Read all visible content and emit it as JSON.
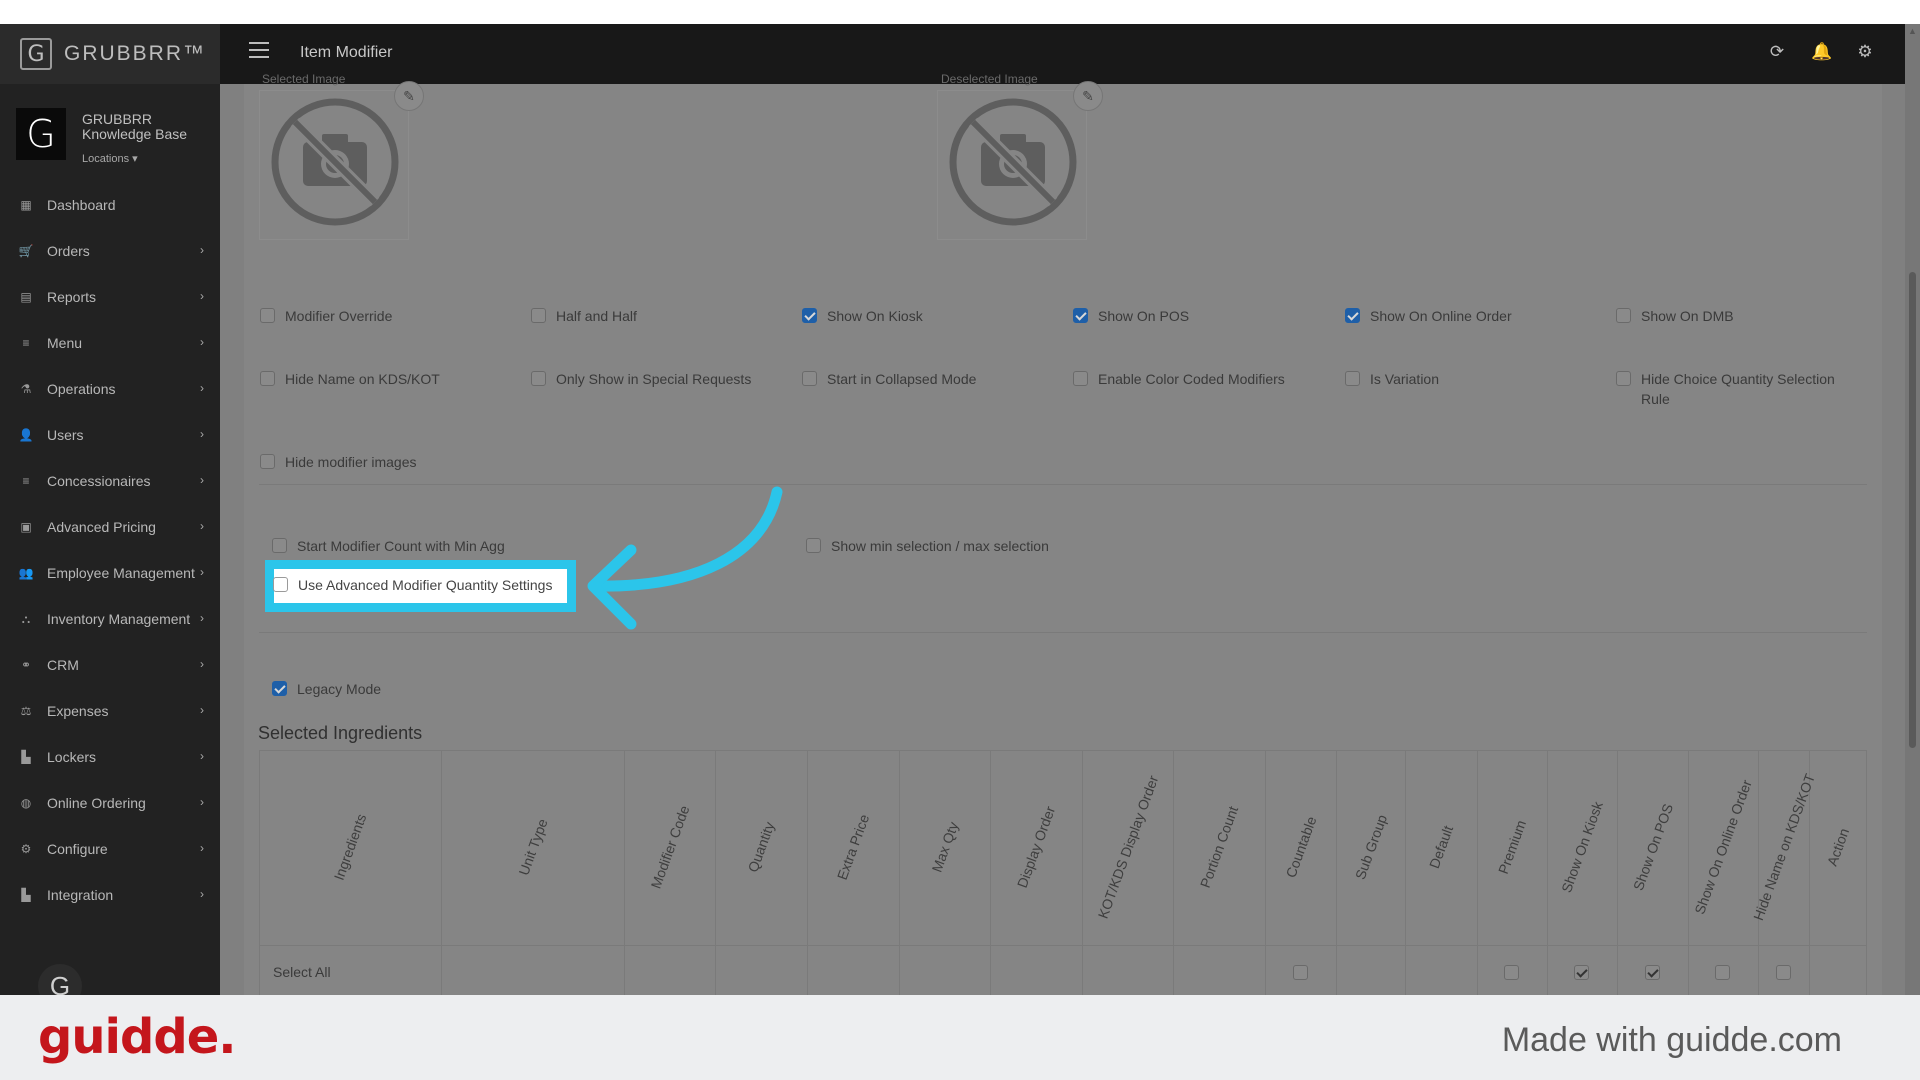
{
  "app": {
    "brand": "GRUBBRR™",
    "brand_letter": "G",
    "page_title": "Item Modifier"
  },
  "header_icons": [
    "refresh-icon",
    "bell-icon",
    "gear-icon"
  ],
  "profile": {
    "name": "GRUBBRR Knowledge Base",
    "locations": "Locations ▾"
  },
  "sidebar": {
    "items": [
      {
        "label": "Dashboard",
        "icon": "▦",
        "chevron": false
      },
      {
        "label": "Orders",
        "icon": "🛒",
        "chevron": true
      },
      {
        "label": "Reports",
        "icon": "▤",
        "chevron": true
      },
      {
        "label": "Menu",
        "icon": "≡",
        "chevron": true
      },
      {
        "label": "Operations",
        "icon": "⚗",
        "chevron": true
      },
      {
        "label": "Users",
        "icon": "👤",
        "chevron": true
      },
      {
        "label": "Concessionaires",
        "icon": "≡",
        "chevron": true
      },
      {
        "label": "Advanced Pricing",
        "icon": "▣",
        "chevron": true
      },
      {
        "label": "Employee Management",
        "icon": "👥",
        "chevron": true
      },
      {
        "label": "Inventory Management",
        "icon": "⛬",
        "chevron": true
      },
      {
        "label": "CRM",
        "icon": "⚭",
        "chevron": true
      },
      {
        "label": "Expenses",
        "icon": "⚖",
        "chevron": true
      },
      {
        "label": "Lockers",
        "icon": "▙",
        "chevron": true
      },
      {
        "label": "Online Ordering",
        "icon": "◍",
        "chevron": true
      },
      {
        "label": "Configure",
        "icon": "⚙",
        "chevron": true
      },
      {
        "label": "Integration",
        "icon": "▙",
        "chevron": true
      }
    ],
    "chevron_glyph": "›",
    "avatar_letter": "G"
  },
  "images": {
    "left_label": "Selected Image",
    "right_label": "Deselected Image"
  },
  "options_row1": [
    {
      "label": "Modifier Override",
      "checked": false
    },
    {
      "label": "Half and Half",
      "checked": false
    },
    {
      "label": "Show On Kiosk",
      "checked": true
    },
    {
      "label": "Show On POS",
      "checked": true
    },
    {
      "label": "Show On Online Order",
      "checked": true
    },
    {
      "label": "Show On DMB",
      "checked": false
    }
  ],
  "options_row2": [
    {
      "label": "Hide Name on KDS/KOT",
      "checked": false
    },
    {
      "label": "Only Show in Special Requests",
      "checked": false
    },
    {
      "label": "Start in Collapsed Mode",
      "checked": false
    },
    {
      "label": "Enable Color Coded Modifiers",
      "checked": false
    },
    {
      "label": "Is Variation",
      "checked": false
    },
    {
      "label": "Hide Choice Quantity Selection Rule",
      "checked": false
    }
  ],
  "options_row3": [
    {
      "label": "Hide modifier images",
      "checked": false
    }
  ],
  "count_options": [
    {
      "label": "Start Modifier Count with Min Agg",
      "checked": false
    },
    {
      "label": "Show min selection / max selection",
      "checked": false
    }
  ],
  "advanced": {
    "label": "Use Advanced Modifier Quantity Settings",
    "checked": false
  },
  "legacy": {
    "label": "Legacy Mode",
    "checked": true
  },
  "ingredients": {
    "title": "Selected Ingredients",
    "columns": [
      "Ingredients",
      "Unit Type",
      "Modifier Code",
      "Quantity",
      "Extra Price",
      "Max Qty",
      "Display Order",
      "KOT/KDS Display Order",
      "Portion Count",
      "Countable",
      "Sub Group",
      "Default",
      "Premium",
      "Show On Kiosk",
      "Show On POS",
      "Show On Online Order",
      "Hide Name on KDS/KOT",
      "Action"
    ],
    "select_all_label": "Select All",
    "select_all_checks": {
      "Countable": false,
      "Premium": false,
      "Show On Kiosk": true,
      "Show On POS": true,
      "Show On Online Order": false,
      "Hide Name on KDS/KOT": false
    }
  },
  "footer": {
    "logo": "guidde.",
    "tagline": "Made with guidde.com"
  },
  "colors": {
    "accent_highlight": "#2bc5ea",
    "checkbox_checked": "#1e5fa8",
    "guidde_red": "#c4161c"
  }
}
